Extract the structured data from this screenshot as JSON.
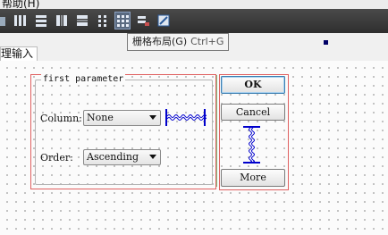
{
  "menubar": {
    "help_label": "帮助(H)"
  },
  "toolbar": {
    "tooltip": {
      "text": "栅格布局(G)",
      "shortcut": "Ctrl+G"
    }
  },
  "tabs": {
    "active_label": "理输入"
  },
  "form": {
    "groupbox_title": "first parameter",
    "column_label": "Column:",
    "column_value": "None",
    "order_label": "Order:",
    "order_value": "Ascending",
    "ok_label": "OK",
    "cancel_label": "Cancel",
    "more_label": "More"
  },
  "colors": {
    "selection": "#e06060",
    "spacer": "#0000cc",
    "toolbar_bg": "#3a3a3a"
  }
}
